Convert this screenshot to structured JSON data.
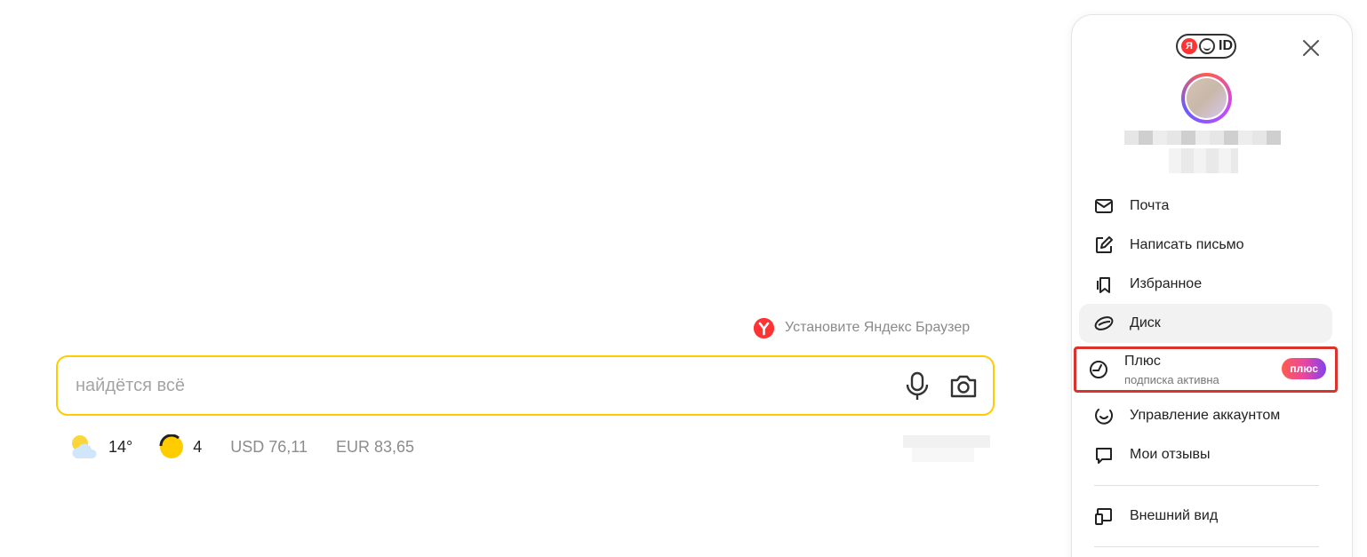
{
  "promo": {
    "text": "Установите Яндекс Браузер",
    "icon": "yandex-browser-icon"
  },
  "search": {
    "placeholder": "найдётся всё",
    "value": ""
  },
  "informers": {
    "weather": {
      "icon": "cloud-sun-icon",
      "value": "14°"
    },
    "traffic": {
      "icon": "traffic-score-icon",
      "value": "4"
    },
    "usd": "USD 76,11",
    "eur": "EUR 83,65"
  },
  "account_panel": {
    "logo_text": "ID",
    "logo_ya": "Я",
    "menu": [
      {
        "label": "Почта",
        "icon": "mail-icon"
      },
      {
        "label": "Написать письмо",
        "icon": "compose-icon"
      },
      {
        "label": "Избранное",
        "icon": "bookmarks-icon"
      },
      {
        "label": "Диск",
        "icon": "disk-icon"
      },
      {
        "label": "Плюс",
        "sublabel": "подписка активна",
        "badge": "плюс",
        "icon": "plus-icon"
      },
      {
        "label": "Управление аккаунтом",
        "icon": "account-icon"
      },
      {
        "label": "Мои отзывы",
        "icon": "reviews-icon"
      },
      {
        "label": "Внешний вид",
        "icon": "appearance-icon"
      }
    ]
  },
  "colors": {
    "search_border": "#ffcc00",
    "plus_highlight": "#d9332b",
    "plus_badge": [
      "#ff5c4d",
      "#eb469f",
      "#8341ef"
    ]
  }
}
